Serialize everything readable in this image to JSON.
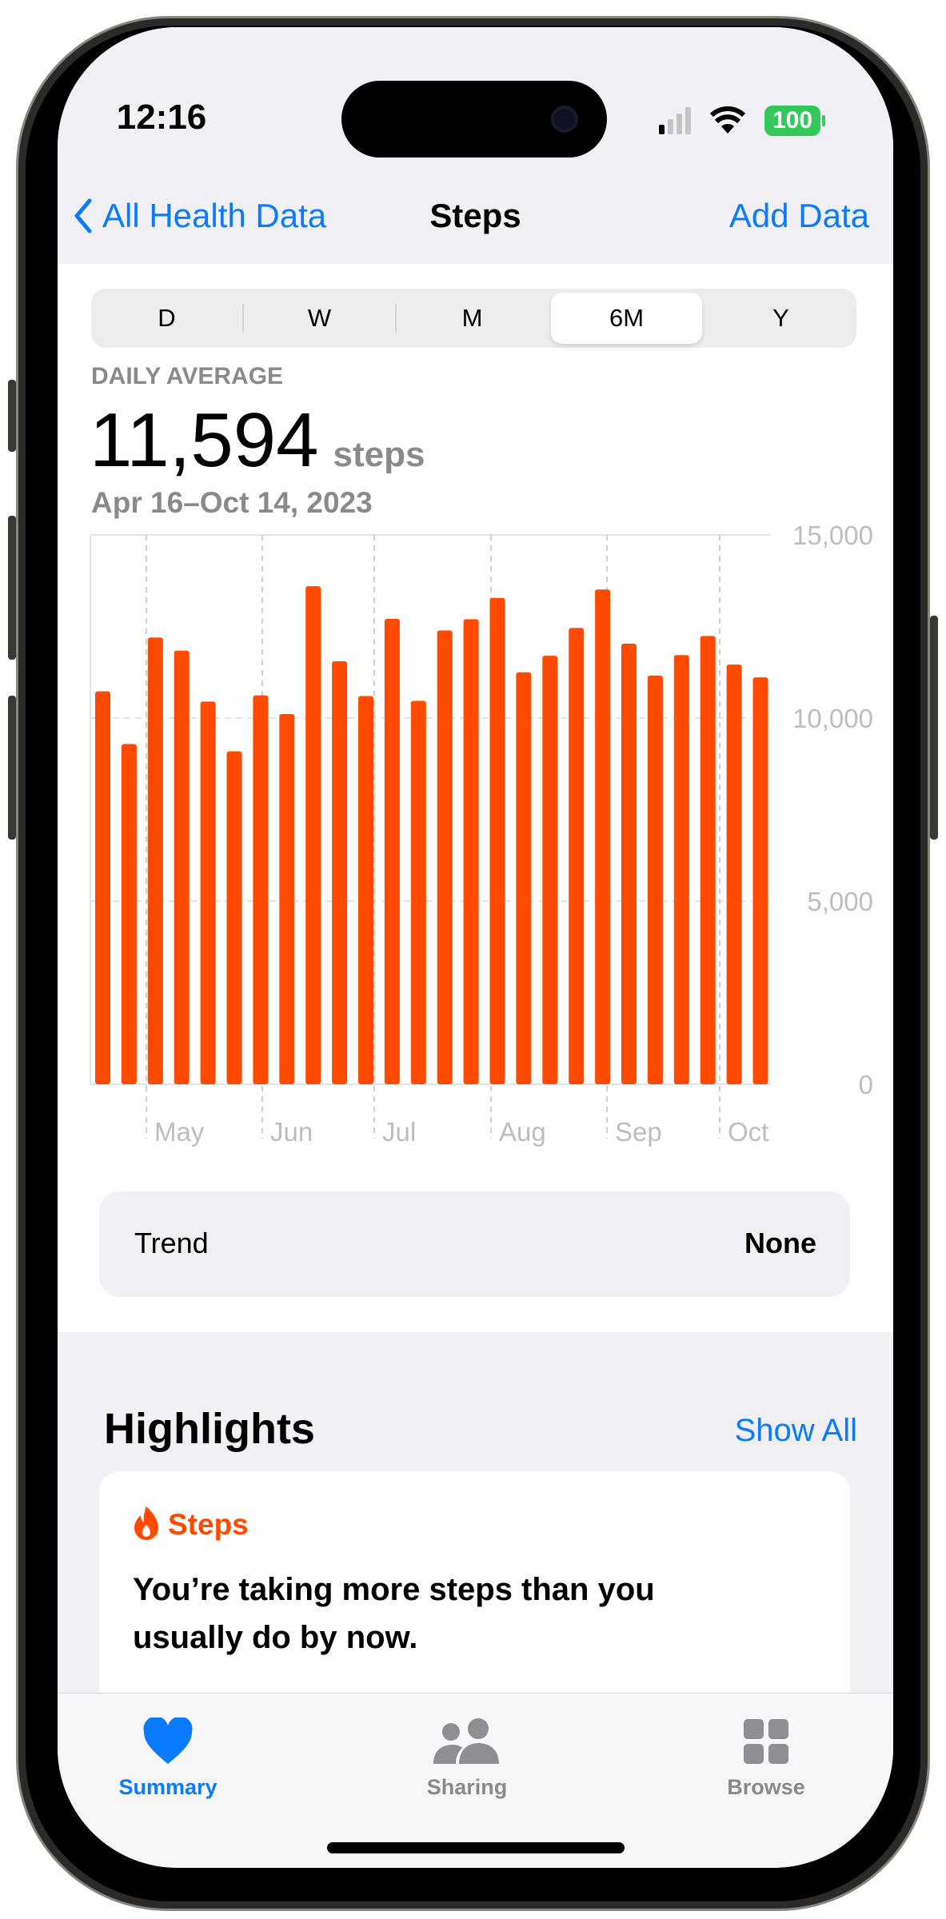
{
  "status": {
    "time": "12:16",
    "battery": "100",
    "battery_color": "#34c759"
  },
  "nav": {
    "back_label": "All Health Data",
    "title": "Steps",
    "action": "Add Data"
  },
  "segments": {
    "items": [
      "D",
      "W",
      "M",
      "6M",
      "Y"
    ],
    "selected": "6M"
  },
  "summary": {
    "label": "DAILY AVERAGE",
    "value": "11,594",
    "unit": "steps",
    "range": "Apr 16–Oct 14, 2023"
  },
  "chart_data": {
    "type": "bar",
    "ylim": [
      0,
      15000
    ],
    "yticks": [
      "0",
      "5,000",
      "10,000",
      "15,000"
    ],
    "month_labels": [
      "May",
      "Jun",
      "Jul",
      "Aug",
      "Sep",
      "Oct"
    ],
    "values": [
      10730,
      9290,
      12200,
      11840,
      10450,
      9090,
      10620,
      10110,
      13600,
      11550,
      10600,
      12710,
      10470,
      12390,
      12700,
      13280,
      11250,
      11700,
      12460,
      13510,
      12030,
      11160,
      11720,
      12240,
      11460,
      11110
    ],
    "color": "#ff4a00",
    "grid": true
  },
  "trend": {
    "label": "Trend",
    "value": "None"
  },
  "highlights": {
    "title": "Highlights",
    "show_all": "Show All",
    "card": {
      "category": "Steps",
      "text": "You’re taking more steps than you usually do by now.",
      "accent": "#ff4a00"
    }
  },
  "tabs": [
    {
      "label": "Summary",
      "icon": "heart-icon",
      "active": true
    },
    {
      "label": "Sharing",
      "icon": "people-icon"
    },
    {
      "label": "Browse",
      "icon": "grid-icon"
    }
  ],
  "colors": {
    "accent": "#0a7aff"
  }
}
